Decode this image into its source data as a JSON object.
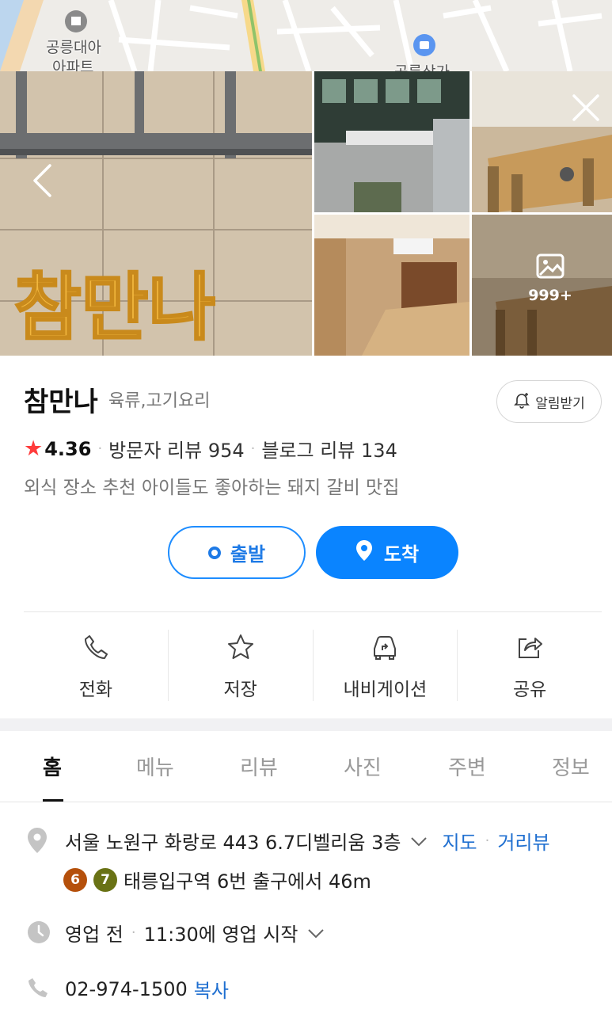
{
  "map": {
    "labels": [
      "공릉대아",
      "아파트",
      "공릉상가"
    ]
  },
  "gallery": {
    "back_icon": "chevron-left-icon",
    "close_icon": "close-icon",
    "photo_count": "999+",
    "sign_text": "참만나"
  },
  "place": {
    "name": "참만나",
    "category": "육류,고기요리",
    "alarm_label": "알림받기",
    "rating": "4.36",
    "visitor_reviews": "방문자 리뷰 954",
    "blog_reviews": "블로그 리뷰 134",
    "description": "외식 장소 추천 아이들도 좋아하는 돼지 갈비 맛집"
  },
  "route": {
    "start_label": "출발",
    "end_label": "도착"
  },
  "actions": [
    {
      "label": "전화",
      "icon": "phone-icon"
    },
    {
      "label": "저장",
      "icon": "star-icon"
    },
    {
      "label": "내비게이션",
      "icon": "car-navigation-icon"
    },
    {
      "label": "공유",
      "icon": "share-icon"
    }
  ],
  "tabs": [
    "홈",
    "메뉴",
    "리뷰",
    "사진",
    "주변",
    "정보"
  ],
  "details": {
    "address": "서울 노원구 화랑로 443 6.7디벨리움 3층",
    "map_link": "지도",
    "street_view_link": "거리뷰",
    "subway_lines": [
      {
        "line": "6",
        "color": "#b5500b"
      },
      {
        "line": "7",
        "color": "#697215"
      }
    ],
    "subway_text": "태릉입구역 6번 출구에서 46m",
    "hours_status": "영업 전",
    "hours_text": "11:30에 영업 시작",
    "phone": "02-974-1500",
    "copy_label": "복사"
  },
  "colors": {
    "accent": "#0a84ff",
    "link": "#1f6fd0",
    "star": "#ff3b3b"
  }
}
